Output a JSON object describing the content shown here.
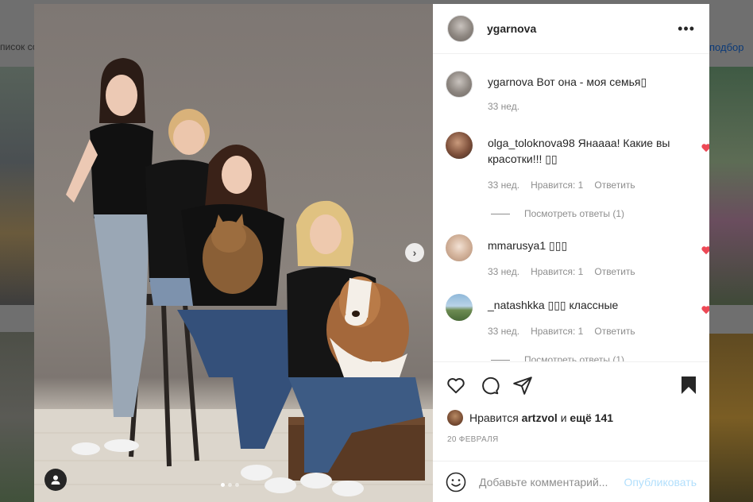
{
  "background": {
    "left_text": "писок со",
    "right_text": "подбор"
  },
  "post": {
    "owner": "ygarnova",
    "caption": "Вот она - моя семья",
    "caption_time": "33 нед.",
    "carousel": {
      "current": 1,
      "total": 3
    }
  },
  "comments": [
    {
      "user": "olga_toloknova98",
      "text": "Янаааа! Какие вы красотки!!! ",
      "time": "33 нед.",
      "likes": "Нравится: 1",
      "reply": "Ответить",
      "view_replies": "Посмотреть ответы (1)",
      "liked": true
    },
    {
      "user": "mmarusya1",
      "text": "",
      "time": "33 нед.",
      "likes": "Нравится: 1",
      "reply": "Ответить",
      "liked": true
    },
    {
      "user": "_natashkka",
      "text": " классные",
      "time": "33 нед.",
      "likes": "Нравится: 1",
      "reply": "Ответить",
      "view_replies": "Посмотреть ответы (1)",
      "liked": true
    }
  ],
  "likes_bar": {
    "prefix": "Нравится",
    "user": "artzvol",
    "middle": "и",
    "others": "ещё 141"
  },
  "date": "20 ФЕВРАЛЯ",
  "add_comment": {
    "placeholder": "Добавьте комментарий...",
    "publish": "Опубликовать"
  },
  "colors": {
    "heart_red": "#ed4956",
    "text": "#262626",
    "muted": "#8e8e8e",
    "publish_disabled": "#b2dffc"
  },
  "icons": [
    "more-icon",
    "heart-icon",
    "comment-icon",
    "share-icon",
    "bookmark-icon",
    "emoji-icon",
    "user-tag-icon",
    "chevron-right-icon"
  ]
}
